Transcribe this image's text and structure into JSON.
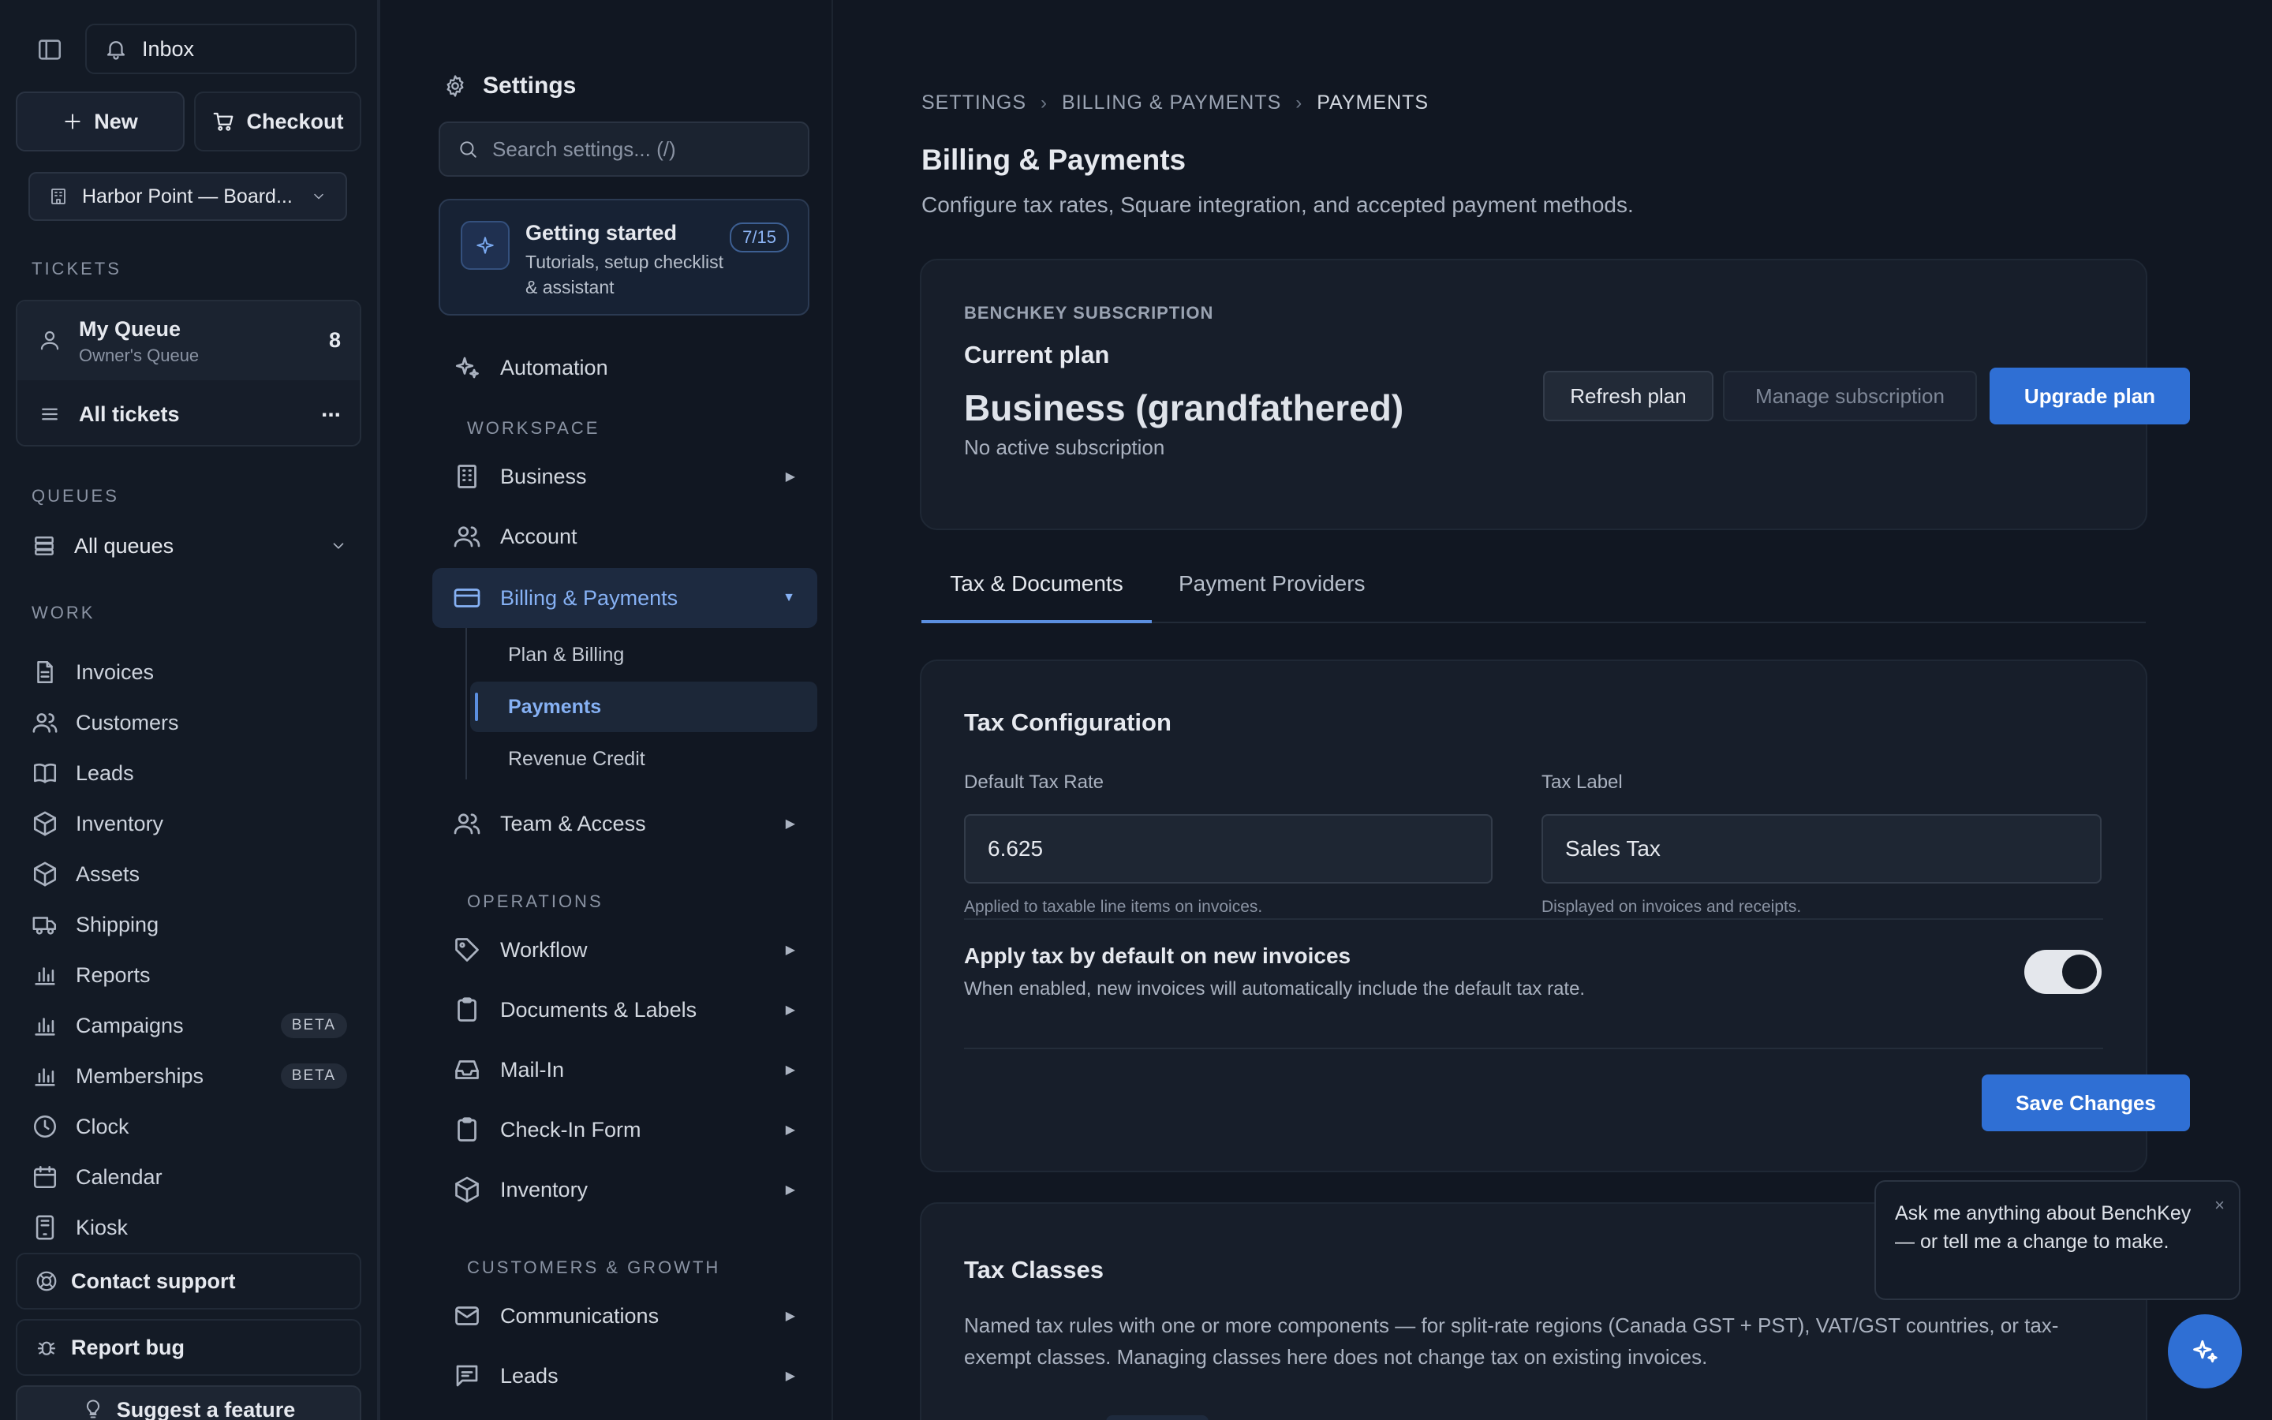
{
  "sidebar": {
    "inbox": "Inbox",
    "new": "New",
    "checkout": "Checkout",
    "location": "Harbor Point — Board...",
    "tickets_label": "TICKETS",
    "my_queue": {
      "title": "My Queue",
      "sub": "Owner's Queue",
      "count": "8"
    },
    "all_tickets": {
      "title": "All tickets",
      "more": "..."
    },
    "queues_label": "QUEUES",
    "all_queues": "All queues",
    "work_label": "WORK",
    "work_items": [
      {
        "label": "Invoices",
        "icon": "document-icon"
      },
      {
        "label": "Customers",
        "icon": "users-icon"
      },
      {
        "label": "Leads",
        "icon": "book-icon"
      },
      {
        "label": "Inventory",
        "icon": "box-icon"
      },
      {
        "label": "Assets",
        "icon": "box-icon"
      },
      {
        "label": "Shipping",
        "icon": "truck-icon"
      },
      {
        "label": "Reports",
        "icon": "bar-chart-icon"
      },
      {
        "label": "Campaigns",
        "icon": "bar-chart-icon",
        "badge": "BETA"
      },
      {
        "label": "Memberships",
        "icon": "bar-chart-icon",
        "badge": "BETA"
      },
      {
        "label": "Clock",
        "icon": "clock-icon"
      },
      {
        "label": "Calendar",
        "icon": "calendar-icon"
      },
      {
        "label": "Kiosk",
        "icon": "tablet-icon"
      }
    ],
    "contact_support": "Contact support",
    "report_bug": "Report bug",
    "suggest_feature": "Suggest a feature"
  },
  "settings_nav": {
    "title": "Settings",
    "search_placeholder": "Search settings... (/)",
    "getting_started": {
      "title": "Getting started",
      "desc": "Tutorials, setup checklist & assistant",
      "progress": "7/15"
    },
    "automation": "Automation",
    "workspace_label": "WORKSPACE",
    "business": "Business",
    "account": "Account",
    "billing": "Billing & Payments",
    "billing_sub": [
      "Plan & Billing",
      "Payments",
      "Revenue Credit"
    ],
    "team": "Team & Access",
    "operations_label": "OPERATIONS",
    "workflow": "Workflow",
    "documents": "Documents & Labels",
    "mailin": "Mail-In",
    "checkin": "Check-In Form",
    "inventory": "Inventory",
    "growth_label": "CUSTOMERS & GROWTH",
    "communications": "Communications",
    "leads": "Leads"
  },
  "main": {
    "breadcrumb": [
      "SETTINGS",
      "BILLING & PAYMENTS",
      "PAYMENTS"
    ],
    "breadcrumb_sep": "›",
    "title": "Billing & Payments",
    "subtitle": "Configure tax rates, Square integration, and accepted payment methods.",
    "plan": {
      "eyebrow": "BENCHKEY SUBSCRIPTION",
      "current_plan": "Current plan",
      "name": "Business (grandfathered)",
      "status": "No active subscription",
      "refresh": "Refresh plan",
      "manage": "Manage subscription",
      "upgrade": "Upgrade plan"
    },
    "tabs": [
      "Tax & Documents",
      "Payment Providers"
    ],
    "tax": {
      "title": "Tax Configuration",
      "rate_label": "Default Tax Rate",
      "rate_value": "6.625",
      "rate_unit": "%",
      "rate_help": "Applied to taxable line items on invoices.",
      "label_label": "Tax Label",
      "label_value": "Sales Tax",
      "label_help": "Displayed on invoices and receipts.",
      "apply_title": "Apply tax by default on new invoices",
      "apply_desc": "When enabled, new invoices will automatically include the default tax rate.",
      "apply_enabled": true,
      "save": "Save Changes"
    },
    "classes": {
      "title": "Tax Classes",
      "desc": "Named tax rules with one or more components — for split-rate regions (Canada GST + PST), VAT/GST countries, or tax-exempt classes. Managing classes here does not change tax on existing invoices."
    }
  },
  "assistant": {
    "tip": "Ask me anything about BenchKey — or tell me a change to make.",
    "close": "×"
  },
  "colors": {
    "accent": "#2f6fd4",
    "background": "#111722",
    "card": "#171e2a",
    "active_link": "#86b1f4"
  }
}
